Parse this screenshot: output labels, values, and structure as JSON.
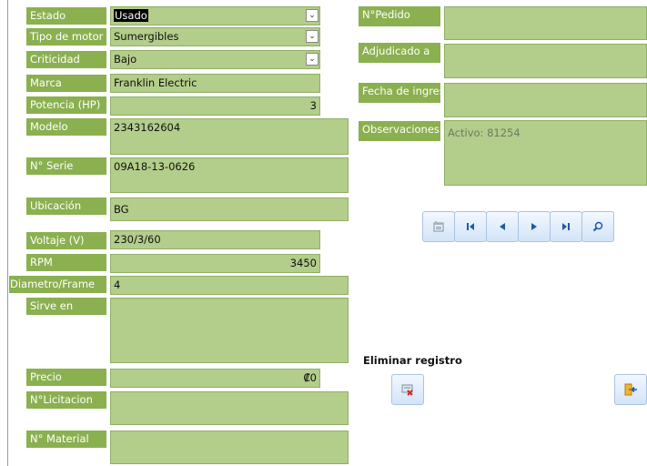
{
  "form": {
    "estado": {
      "label": "Estado",
      "value": "Usado"
    },
    "tipo_motor": {
      "label": "Tipo de motor",
      "value": "Sumergibles"
    },
    "criticidad": {
      "label": "Criticidad",
      "value": "Bajo"
    },
    "marca": {
      "label": "Marca",
      "value": "Franklin Electric"
    },
    "potencia": {
      "label": "Potencia (HP)",
      "value": "3"
    },
    "modelo": {
      "label": "Modelo",
      "value": "2343162604"
    },
    "serie": {
      "label": "N° Serie",
      "value": "09A18-13-0626"
    },
    "ubicacion": {
      "label": "Ubicación",
      "value": "BG"
    },
    "voltaje": {
      "label": "Voltaje (V)",
      "value": "230/3/60"
    },
    "rpm": {
      "label": "RPM",
      "value": "3450"
    },
    "diametro": {
      "label": "Diametro/Frame",
      "value": "4"
    },
    "sirve_en": {
      "label": "Sirve en",
      "value": ""
    },
    "precio": {
      "label": "Precio",
      "value": "₡0"
    },
    "licitacion": {
      "label": "N°Licitacion",
      "value": ""
    },
    "material": {
      "label": "N° Material",
      "value": ""
    },
    "pedido": {
      "label": "N°Pedido",
      "value": ""
    },
    "adjudicado": {
      "label": "Adjudicado a",
      "value": ""
    },
    "fecha_ingreso": {
      "label": "Fecha de ingres",
      "value": ""
    },
    "observaciones": {
      "label": "Observaciones",
      "value": "Activo: 81254"
    }
  },
  "actions": {
    "delete_label": "Eliminar registro"
  },
  "icons": {
    "dropdown": "chevron-down-icon",
    "new_record": "new-record-icon",
    "first": "first-record-icon",
    "previous": "previous-record-icon",
    "next": "next-record-icon",
    "last": "last-record-icon",
    "search": "search-icon",
    "delete": "delete-record-icon",
    "exit": "exit-icon"
  },
  "colors": {
    "label_bg": "#8bb050",
    "field_bg": "#b3cd8a",
    "button_bg": "#d3e4f7",
    "nav_icon": "#1d5aa8"
  }
}
